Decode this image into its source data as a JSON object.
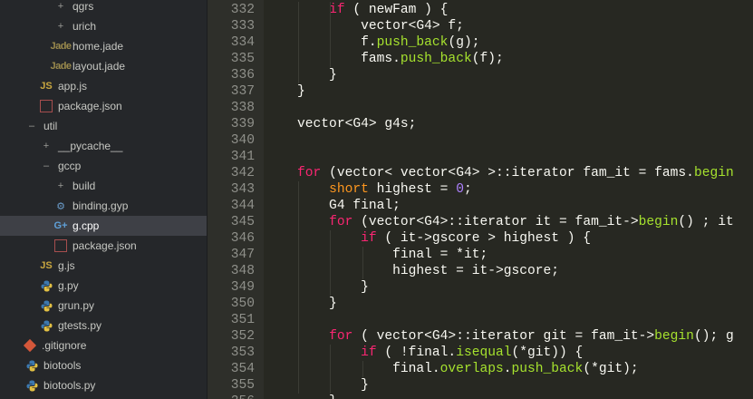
{
  "sidebar": {
    "items": [
      {
        "label": "qgrs",
        "icon": "plus-icon",
        "indent": 60
      },
      {
        "label": "urich",
        "icon": "plus-icon",
        "indent": 60
      },
      {
        "label": "home.jade",
        "icon": "jade-file-icon",
        "indent": 60
      },
      {
        "label": "layout.jade",
        "icon": "jade-file-icon",
        "indent": 60
      },
      {
        "label": "app.js",
        "icon": "js-file-icon",
        "indent": 44
      },
      {
        "label": "package.json",
        "icon": "json-file-icon",
        "indent": 44
      },
      {
        "label": "util",
        "icon": "minus-icon",
        "indent": 28
      },
      {
        "label": "__pycache__",
        "icon": "plus-icon",
        "indent": 44
      },
      {
        "label": "gccp",
        "icon": "minus-icon",
        "indent": 44
      },
      {
        "label": "build",
        "icon": "plus-icon",
        "indent": 60
      },
      {
        "label": "binding.gyp",
        "icon": "gear-icon",
        "indent": 60
      },
      {
        "label": "g.cpp",
        "icon": "cpp-file-icon",
        "indent": 60,
        "selected": true
      },
      {
        "label": "package.json",
        "icon": "json-file-icon",
        "indent": 60
      },
      {
        "label": "g.js",
        "icon": "js-file-icon",
        "indent": 44
      },
      {
        "label": "g.py",
        "icon": "python-file-icon",
        "indent": 44
      },
      {
        "label": "grun.py",
        "icon": "python-file-icon",
        "indent": 44
      },
      {
        "label": "gtests.py",
        "icon": "python-file-icon",
        "indent": 44
      },
      {
        "label": ".gitignore",
        "icon": "git-icon",
        "indent": 28
      },
      {
        "label": "biotools",
        "icon": "python-file-icon",
        "indent": 28
      },
      {
        "label": "biotools.py",
        "icon": "python-file-icon",
        "indent": 28
      }
    ]
  },
  "editor": {
    "lines": [
      {
        "num": "332",
        "tokens": [
          [
            "        ",
            ""
          ],
          [
            "if",
            "kw"
          ],
          [
            " ( newFam ) {",
            ""
          ]
        ]
      },
      {
        "num": "333",
        "tokens": [
          [
            "            vector<G4> f;",
            ""
          ]
        ]
      },
      {
        "num": "334",
        "tokens": [
          [
            "            f.",
            ""
          ],
          [
            "push_back",
            "fn"
          ],
          [
            "(g);",
            ""
          ]
        ]
      },
      {
        "num": "335",
        "tokens": [
          [
            "            fams.",
            ""
          ],
          [
            "push_back",
            "fn"
          ],
          [
            "(f);",
            ""
          ]
        ]
      },
      {
        "num": "336",
        "tokens": [
          [
            "        }",
            ""
          ]
        ]
      },
      {
        "num": "337",
        "tokens": [
          [
            "    }",
            ""
          ]
        ]
      },
      {
        "num": "338",
        "tokens": [
          [
            "",
            ""
          ]
        ]
      },
      {
        "num": "339",
        "tokens": [
          [
            "    vector<G4> g4s;",
            ""
          ]
        ]
      },
      {
        "num": "340",
        "tokens": [
          [
            "",
            ""
          ]
        ]
      },
      {
        "num": "341",
        "tokens": [
          [
            "",
            ""
          ]
        ]
      },
      {
        "num": "342",
        "tokens": [
          [
            "    ",
            ""
          ],
          [
            "for",
            "kw"
          ],
          [
            " (vector< vector<G4> >::iterator fam_it = fams.",
            ""
          ],
          [
            "begin",
            "fn"
          ]
        ]
      },
      {
        "num": "343",
        "tokens": [
          [
            "        ",
            ""
          ],
          [
            "short",
            "ty"
          ],
          [
            " highest = ",
            ""
          ],
          [
            "0",
            "nm"
          ],
          [
            ";",
            ""
          ]
        ]
      },
      {
        "num": "344",
        "tokens": [
          [
            "        G4 final;",
            ""
          ]
        ]
      },
      {
        "num": "345",
        "tokens": [
          [
            "        ",
            ""
          ],
          [
            "for",
            "kw"
          ],
          [
            " (vector<G4>::iterator it = fam_it->",
            ""
          ],
          [
            "begin",
            "fn"
          ],
          [
            "() ; it",
            ""
          ]
        ]
      },
      {
        "num": "346",
        "tokens": [
          [
            "            ",
            ""
          ],
          [
            "if",
            "kw"
          ],
          [
            " ( it->gscore > highest ) {",
            ""
          ]
        ]
      },
      {
        "num": "347",
        "tokens": [
          [
            "                final = *it;",
            ""
          ]
        ]
      },
      {
        "num": "348",
        "tokens": [
          [
            "                highest = it->gscore;",
            ""
          ]
        ]
      },
      {
        "num": "349",
        "tokens": [
          [
            "            }",
            ""
          ]
        ]
      },
      {
        "num": "350",
        "tokens": [
          [
            "        }",
            ""
          ]
        ]
      },
      {
        "num": "351",
        "tokens": [
          [
            "",
            ""
          ]
        ]
      },
      {
        "num": "352",
        "tokens": [
          [
            "        ",
            ""
          ],
          [
            "for",
            "kw"
          ],
          [
            " ( vector<G4>::iterator git = fam_it->",
            ""
          ],
          [
            "begin",
            "fn"
          ],
          [
            "(); g",
            ""
          ]
        ]
      },
      {
        "num": "353",
        "tokens": [
          [
            "            ",
            ""
          ],
          [
            "if",
            "kw"
          ],
          [
            " ( !final.",
            ""
          ],
          [
            "isequal",
            "fn"
          ],
          [
            "(*git)) {",
            ""
          ]
        ]
      },
      {
        "num": "354",
        "tokens": [
          [
            "                final.",
            ""
          ],
          [
            "overlaps",
            "fn"
          ],
          [
            ".",
            ""
          ],
          [
            "push_back",
            "fn"
          ],
          [
            "(*git);",
            ""
          ]
        ]
      },
      {
        "num": "355",
        "tokens": [
          [
            "            }",
            ""
          ]
        ]
      },
      {
        "num": "356",
        "tokens": [
          [
            "        }",
            ""
          ]
        ]
      }
    ]
  }
}
